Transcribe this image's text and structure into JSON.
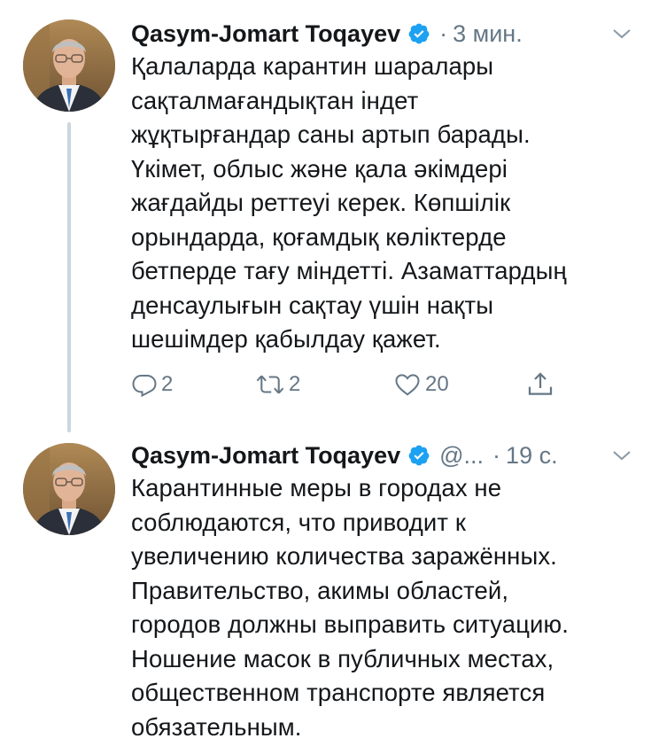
{
  "thread": [
    {
      "author_name": "Qasym-Jomart Toqayev",
      "handle": "",
      "separator": "·",
      "time": "3 мин.",
      "text": "Қалаларда карантин шаралары\nсақталмағандықтан індет\nжұқтырғандар саны артып барады.\nҮкімет, облыс және қала әкімдері\nжағдайды реттеуі керек. Көпшілік\nорындарда, қоғамдық көліктерде\nбетперде тағу міндетті. Азаматтардың\nденсаулығын сақтау үшін нақты\nшешімдер қабылдау қажет.",
      "reply_count": "2",
      "retweet_count": "2",
      "like_count": "20"
    },
    {
      "author_name": "Qasym-Jomart Toqayev",
      "handle": "@...",
      "separator": "·",
      "time": "19 с.",
      "text": "Карантинные меры в городах не\nсоблюдаются, что приводит к\nувеличению количества заражённых.\nПравительство, акимы областей,\nгородов должны выправить ситуацию.\nНошение масок в публичных местах,\nобщественном транспорте является\nобязательным."
    }
  ],
  "icons": {
    "verified": "verified-badge-icon",
    "menu": "chevron-down-icon",
    "reply": "reply-icon",
    "retweet": "retweet-icon",
    "like": "heart-icon",
    "share": "share-icon"
  },
  "colors": {
    "text": "#14171a",
    "secondary": "#657786",
    "verified": "#1da1f2",
    "thread_line": "#ccd6dd"
  }
}
